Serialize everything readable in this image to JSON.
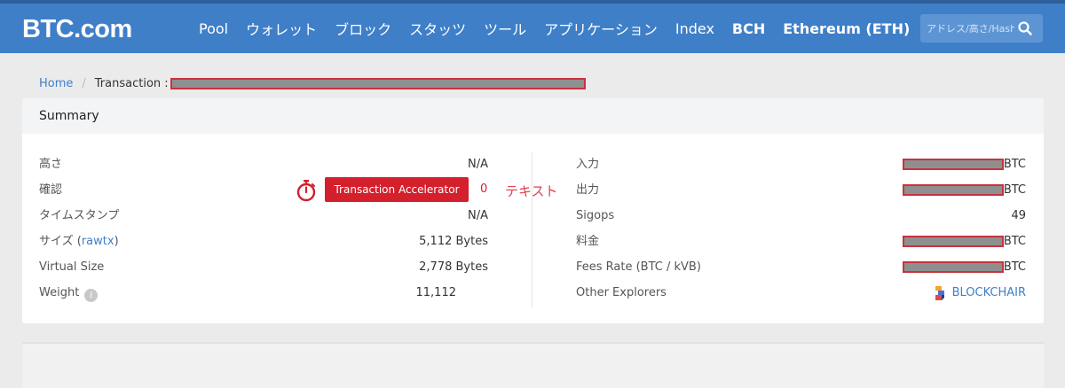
{
  "header": {
    "logo": "BTC.com",
    "nav": [
      {
        "label": "Pool",
        "bold": false
      },
      {
        "label": "ウォレット",
        "bold": false
      },
      {
        "label": "ブロック",
        "bold": false
      },
      {
        "label": "スタッツ",
        "bold": false
      },
      {
        "label": "ツール",
        "bold": false
      },
      {
        "label": "アプリケーション",
        "bold": false
      },
      {
        "label": "Index",
        "bold": false
      },
      {
        "label": "BCH",
        "bold": true
      },
      {
        "label": "Ethereum (ETH)",
        "bold": true
      }
    ],
    "search_placeholder": "アドレス/高さ/Hash",
    "search_icon": "search-icon"
  },
  "breadcrumb": {
    "home": "Home",
    "separator": "/",
    "current": "Transaction :"
  },
  "summary": {
    "title": "Summary",
    "left": {
      "height_label": "高さ",
      "height_value": "N/A",
      "confirm_label": "確認",
      "accelerator_label": "Transaction Accelerator",
      "confirm_value": "0",
      "annotation": "テキスト",
      "timestamp_label": "タイムスタンプ",
      "timestamp_value": "N/A",
      "size_label": "サイズ (",
      "size_link": "rawtx",
      "size_label_end": ")",
      "size_value": "5,112 Bytes",
      "vsize_label": "Virtual Size",
      "vsize_value": "2,778 Bytes",
      "weight_label": "Weight",
      "weight_info": "i",
      "weight_value": "11,112"
    },
    "right": {
      "input_label": "入力",
      "input_unit": "BTC",
      "output_label": "出力",
      "output_unit": "BTC",
      "sigops_label": "Sigops",
      "sigops_value": "49",
      "fee_label": "料金",
      "fee_unit": "BTC",
      "feerate_label": "Fees Rate (BTC / kVB)",
      "feerate_unit": "BTC",
      "explorers_label": "Other Explorers",
      "explorer_link": "BLOCKCHAIR"
    }
  },
  "colors": {
    "header_bg": "#3f7fc8",
    "accent": "#d3202c",
    "link": "#3f7fc8"
  }
}
